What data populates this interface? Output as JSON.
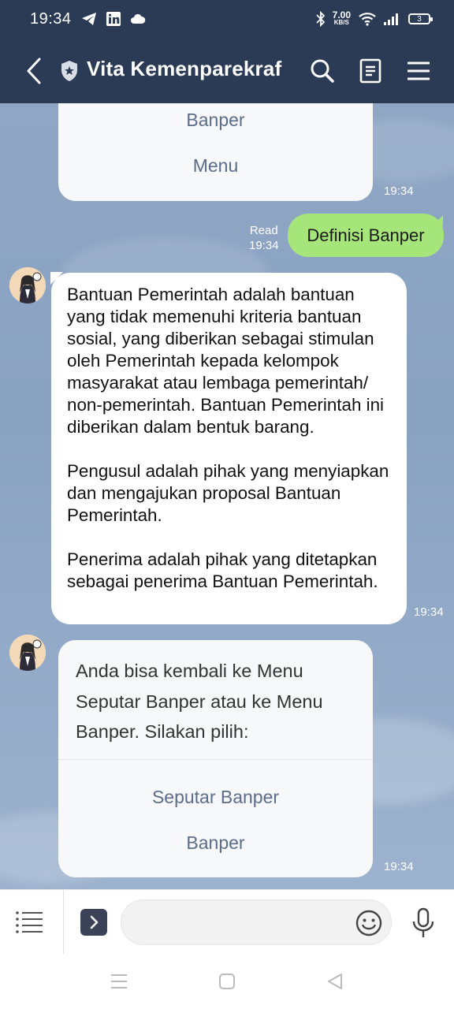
{
  "status_bar": {
    "time": "19:34",
    "net_speed_value": "7.00",
    "net_speed_unit": "KB/S",
    "battery": "3"
  },
  "header": {
    "title": "Vita Kemenparekraf"
  },
  "messages": {
    "card1": {
      "buttons": [
        "Banper",
        "Menu"
      ],
      "time": "19:34"
    },
    "user_msg": {
      "read_label": "Read",
      "time": "19:34",
      "text": "Definisi Banper"
    },
    "bot_text": {
      "paragraphs": [
        "Bantuan Pemerintah adalah bantuan yang tidak memenuhi kriteria bantuan sosial, yang diberikan sebagai stimulan oleh Pemerintah kepada kelompok masyarakat atau lembaga pemerintah/ non-pemerintah. Bantuan Pemerintah ini diberikan dalam bentuk barang.",
        "Pengusul adalah pihak yang menyiapkan dan mengajukan proposal Bantuan Pemerintah.",
        "Penerima adalah pihak yang ditetapkan sebagai penerima Bantuan Pemerintah."
      ],
      "time": "19:34"
    },
    "card2": {
      "text": "Anda bisa kembali ke Menu Seputar Banper atau ke Menu Banper. Silakan pilih:",
      "buttons": [
        "Seputar Banper",
        "Banper"
      ],
      "time": "19:34"
    }
  },
  "colors": {
    "header_bg": "#2b3a55",
    "user_bubble": "#a6e57a",
    "link_text": "#5b6d8a"
  }
}
